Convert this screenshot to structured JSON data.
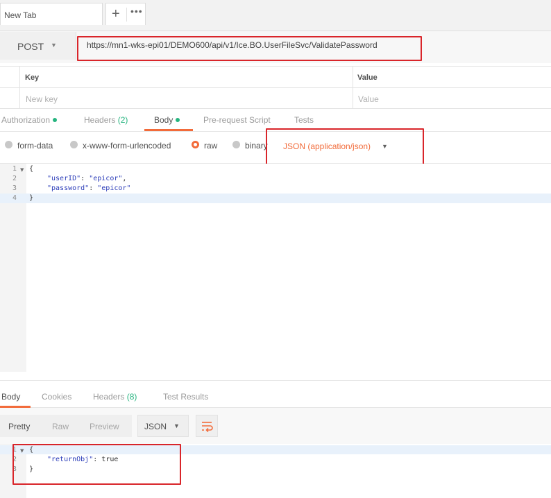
{
  "tab": {
    "title": "New Tab",
    "add_icon": "plus-icon",
    "more_icon": "ellipsis-icon"
  },
  "request": {
    "method": "POST",
    "url": "https://mn1-wks-epi01/DEMO600/api/v1/Ice.BO.UserFileSvc/ValidatePassword"
  },
  "params": {
    "key_header": "Key",
    "value_header": "Value",
    "key_placeholder": "New key",
    "value_placeholder": "Value"
  },
  "request_tabs": {
    "authorization": "Authorization",
    "headers": "Headers",
    "headers_count": "(2)",
    "body": "Body",
    "prerequest": "Pre-request Script",
    "tests": "Tests"
  },
  "body_types": {
    "form_data": "form-data",
    "urlencoded": "x-www-form-urlencoded",
    "raw": "raw",
    "binary": "binary",
    "content_type": "JSON (application/json)"
  },
  "request_body": {
    "line_numbers": [
      "1",
      "2",
      "3",
      "4"
    ],
    "lines": [
      "{",
      "\"userID\": \"epicor\",",
      "\"password\": \"epicor\"",
      "}"
    ],
    "key1": "\"userID\"",
    "val1": "\"epicor\"",
    "key2": "\"password\"",
    "val2": "\"epicor\""
  },
  "response_tabs": {
    "body": "Body",
    "cookies": "Cookies",
    "headers": "Headers",
    "headers_count": "(8)",
    "test_results": "Test Results"
  },
  "response_view": {
    "pretty": "Pretty",
    "raw": "Raw",
    "preview": "Preview",
    "format": "JSON",
    "wrap_icon": "wrap-lines-icon"
  },
  "response_body": {
    "line_numbers": [
      "1",
      "2",
      "3"
    ],
    "open": "{",
    "key": "\"returnObj\"",
    "value": "true",
    "close": "}"
  },
  "colors": {
    "accent": "#f26b3a",
    "highlight_box": "#d9252a",
    "status_dot": "#26b47f",
    "json_key": "#2a3bb8"
  }
}
